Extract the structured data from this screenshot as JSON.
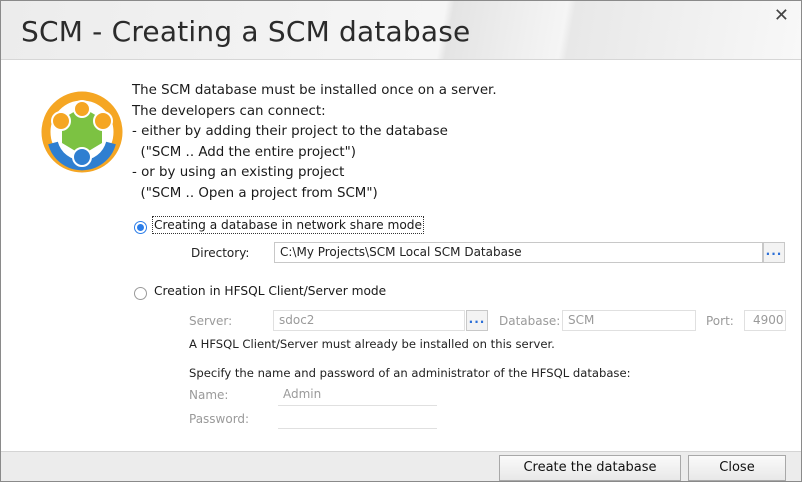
{
  "window": {
    "title": "SCM - Creating a SCM database",
    "close_glyph": "✕"
  },
  "intro_text": "The SCM database must be installed once on a server.\nThe developers can connect:\n- either by adding their project to the database\n  (\"SCM .. Add the entire project\")\n- or by using an existing project\n  (\"SCM .. Open a project from SCM\")",
  "option_network": {
    "label": "Creating a database in network share mode",
    "selected": true,
    "directory_label": "Directory:",
    "directory_value": "C:\\My Projects\\SCM Local SCM Database",
    "browse_label": "..."
  },
  "option_hfsql": {
    "label": "Creation in HFSQL Client/Server mode",
    "selected": false,
    "server_label": "Server:",
    "server_value": "sdoc2",
    "browse_label": "...",
    "database_label": "Database:",
    "database_value": "SCM",
    "port_label": "Port:",
    "port_value": "4900",
    "note": "A HFSQL Client/Server must already be installed on this server.",
    "admin_note": "Specify the name and password of an administrator of the HFSQL database:",
    "name_label": "Name:",
    "name_value": "Admin",
    "password_label": "Password:",
    "password_value": ""
  },
  "buttons": {
    "create": "Create the database",
    "close": "Close"
  },
  "colors": {
    "accent": "#2b7de9",
    "logo_orange": "#f5a623",
    "logo_green": "#7cc242",
    "logo_blue": "#2f7fd1"
  },
  "icons": {
    "logo": "scm-team-logo-icon",
    "close": "close-icon",
    "browse": "ellipsis-icon"
  }
}
